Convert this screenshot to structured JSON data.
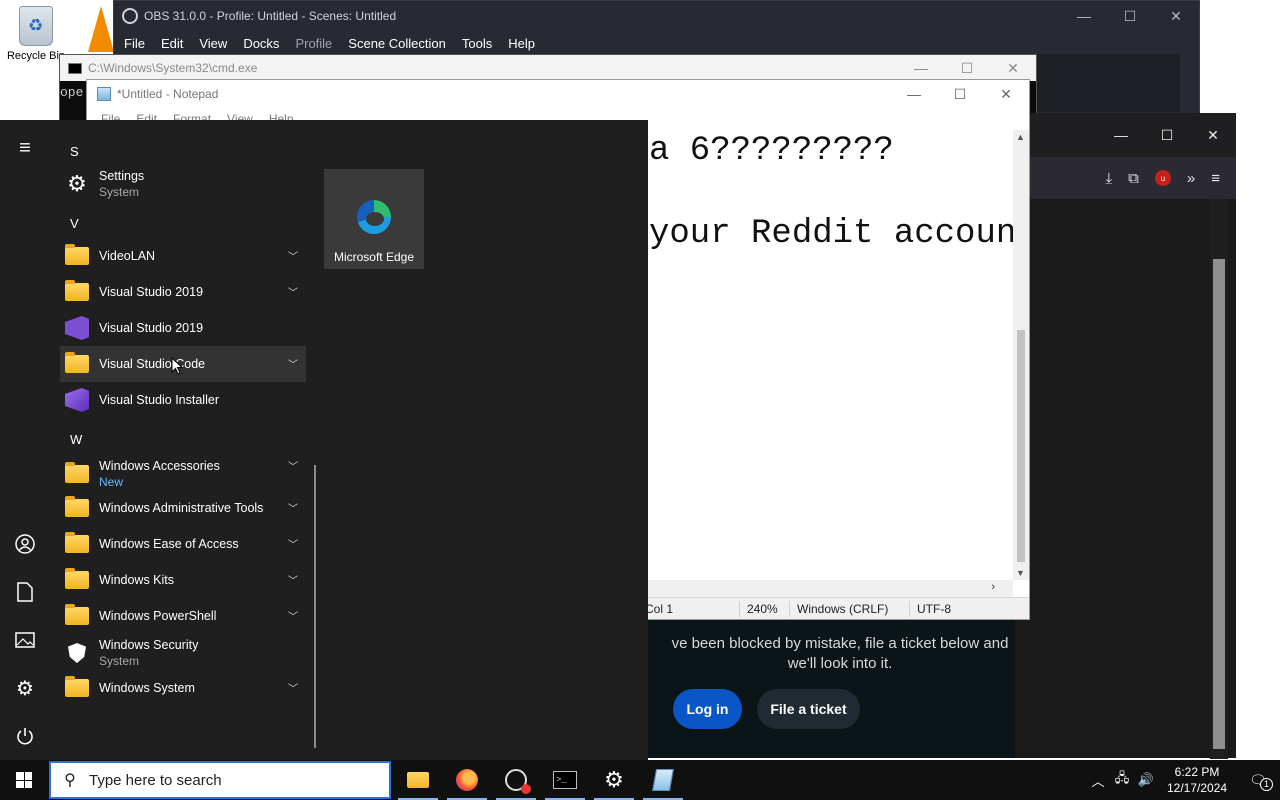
{
  "desktop": {
    "recycle_bin_label": "Recycle Bin",
    "cmd_partial_text": "ope"
  },
  "obs": {
    "title": "OBS 31.0.0 - Profile: Untitled - Scenes: Untitled",
    "menu": [
      "File",
      "Edit",
      "View",
      "Docks",
      "Profile",
      "Scene Collection",
      "Tools",
      "Help"
    ],
    "disabled_menu": "Profile"
  },
  "cmd": {
    "title": "C:\\Windows\\System32\\cmd.exe"
  },
  "notepad": {
    "title": "*Untitled - Notepad",
    "menu": [
      "File",
      "Edit",
      "Format",
      "View",
      "Help"
    ],
    "line1": "a 6?????????",
    "line2": "your Reddit account",
    "status": {
      "position": "Col 1",
      "zoom": "240%",
      "line_ending": "Windows (CRLF)",
      "encoding": "UTF-8"
    }
  },
  "browser_page": {
    "message_line1": "ve been blocked by mistake, file a ticket below and",
    "message_line2": "we'll look into it.",
    "login_label": "Log in",
    "ticket_label": "File a ticket"
  },
  "start_menu": {
    "letters": {
      "s": "S",
      "v": "V",
      "w": "W"
    },
    "apps": [
      {
        "name": "Settings",
        "sub": "System"
      },
      {
        "name": "VideoLAN"
      },
      {
        "name": "Visual Studio 2019"
      },
      {
        "name": "Visual Studio 2019"
      },
      {
        "name": "Visual Studio Code"
      },
      {
        "name": "Visual Studio Installer"
      },
      {
        "name": "Windows Accessories",
        "sub": "New"
      },
      {
        "name": "Windows Administrative Tools"
      },
      {
        "name": "Windows Ease of Access"
      },
      {
        "name": "Windows Kits"
      },
      {
        "name": "Windows PowerShell"
      },
      {
        "name": "Windows Security",
        "sub": "System"
      },
      {
        "name": "Windows System"
      }
    ],
    "tile": {
      "name": "Microsoft Edge"
    }
  },
  "taskbar": {
    "search_placeholder": "Type here to search",
    "time": "6:22 PM",
    "date": "12/17/2024",
    "notification_count": "1"
  },
  "colors": {
    "accent": "#0a56c9",
    "start_bg": "#1f1f1f",
    "taskbar_bg": "#101010"
  }
}
